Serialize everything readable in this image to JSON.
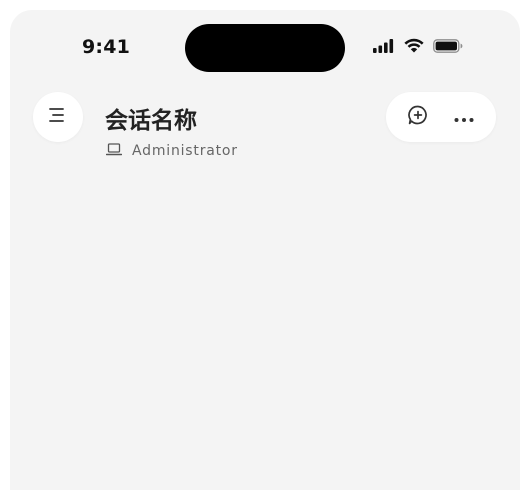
{
  "status_bar": {
    "time": "9:41",
    "icons": [
      "cellular-signal-icon",
      "wifi-icon",
      "battery-icon"
    ]
  },
  "header": {
    "menu_icon": "menu-icon",
    "title": "会话名称",
    "subtitle_icon": "laptop-icon",
    "subtitle": "Administrator",
    "actions": [
      {
        "name": "new-chat",
        "icon": "chat-plus-icon"
      },
      {
        "name": "more",
        "icon": "more-horizontal-icon"
      }
    ]
  },
  "colors": {
    "background": "#f4f4f4",
    "surface": "#ffffff",
    "text_primary": "#222222",
    "text_secondary": "#666666"
  }
}
